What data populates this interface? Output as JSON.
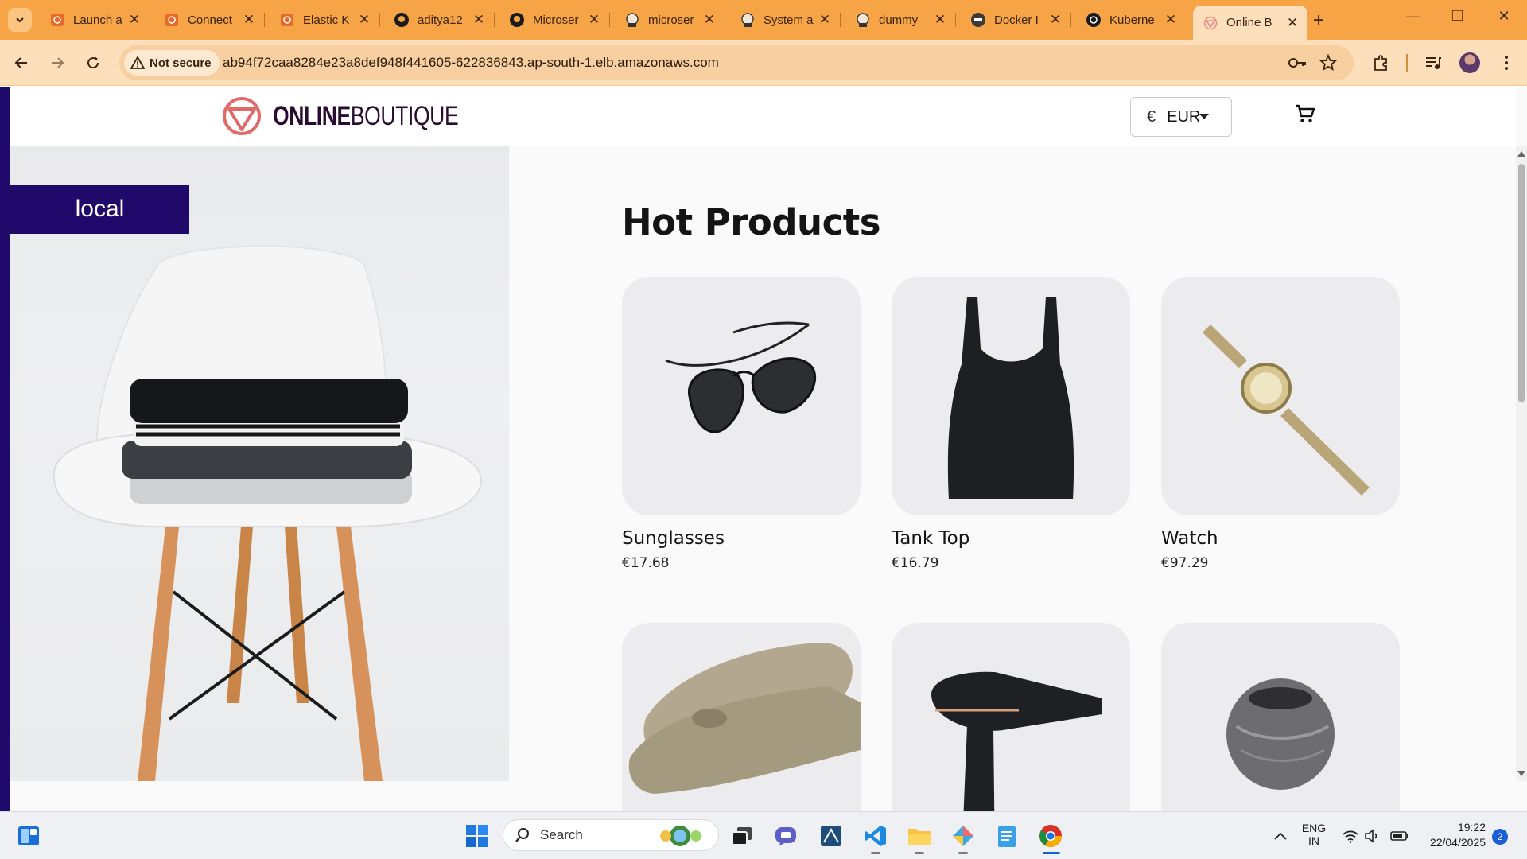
{
  "browser": {
    "tabs": [
      {
        "title": "Launch a",
        "icon": "aws-icon"
      },
      {
        "title": "Connect",
        "icon": "aws-icon"
      },
      {
        "title": "Elastic K",
        "icon": "aws-icon"
      },
      {
        "title": "aditya12",
        "icon": "github-icon"
      },
      {
        "title": "Microser",
        "icon": "github-icon"
      },
      {
        "title": "microser",
        "icon": "jenkins-icon"
      },
      {
        "title": "System a",
        "icon": "jenkins-icon"
      },
      {
        "title": "dummy",
        "icon": "jenkins-icon"
      },
      {
        "title": "Docker I",
        "icon": "docker-icon"
      },
      {
        "title": "Kuberne",
        "icon": "kubernetes-icon"
      },
      {
        "title": "Online B",
        "icon": "boutique-icon",
        "active": true
      }
    ],
    "security_chip": "Not secure",
    "url": "ab94f72caa8284e23a8def948f441605-622836843.ap-south-1.elb.amazonaws.com"
  },
  "site": {
    "logo_bold": "ONLINE",
    "logo_light": "BOUTIQUE",
    "currency_symbol": "€",
    "currency": "EUR",
    "env_badge": "local",
    "section_title": "Hot Products",
    "products": [
      {
        "name": "Sunglasses",
        "price": "€17.68"
      },
      {
        "name": "Tank Top",
        "price": "€16.79"
      },
      {
        "name": "Watch",
        "price": "€97.29"
      },
      {
        "name": "",
        "price": ""
      },
      {
        "name": "",
        "price": ""
      },
      {
        "name": "",
        "price": ""
      }
    ]
  },
  "taskbar": {
    "search_placeholder": "Search",
    "lang_top": "ENG",
    "lang_bottom": "IN",
    "time": "19:22",
    "date": "22/04/2025",
    "notifications": "2"
  },
  "colors": {
    "tabstrip": "#f7a447",
    "toolbar": "#fde0bb",
    "brand_dark": "#2a0c30",
    "brand_accent": "#e06a6a",
    "env_badge": "#1f0a6b"
  }
}
